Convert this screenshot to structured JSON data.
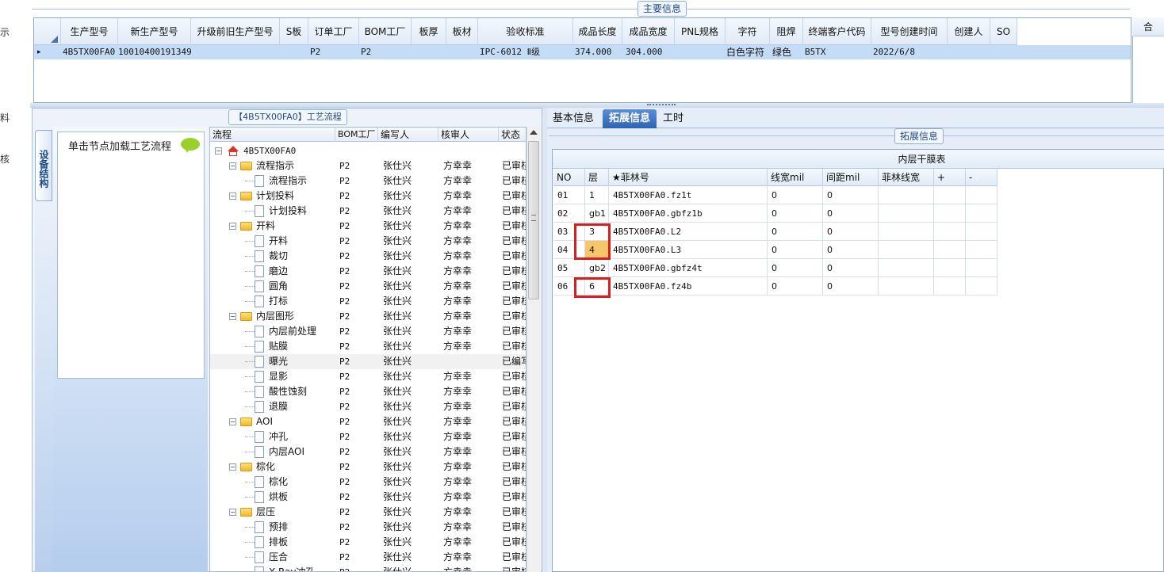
{
  "left_strip": {
    "chars": [
      "示",
      "料",
      "核"
    ]
  },
  "main_info": {
    "title": "主要信息",
    "columns": [
      "生产型号",
      "新生产型号",
      "升级前旧生产型号",
      "S板",
      "订单工厂",
      "BOM工厂",
      "板厚",
      "板材",
      "验收标准",
      "成品长度",
      "成品宽度",
      "PNL规格",
      "字符",
      "阻焊",
      "终端客户代码",
      "型号创建时间",
      "创建人",
      "SO"
    ],
    "row": {
      "indicator": "▸",
      "model": "4B5TX00FA0",
      "new_model": "10010400191349",
      "old_model": "",
      "s_board": "",
      "order_factory": "P2",
      "bom_factory": "P2",
      "thickness": "",
      "material": "",
      "standard": "IPC-6012 Ⅱ级",
      "length": "374.000",
      "width": "304.000",
      "pnl": "",
      "char": "白色字符",
      "mask": "绿色",
      "customer": "B5TX",
      "created": "2022/6/8",
      "creator": "",
      "so": ""
    },
    "right_header": "合"
  },
  "process": {
    "title": "【4B5TX00FA0】工艺流程",
    "vertical_tab": "设备结构",
    "load_hint": "单击节点加载工艺流程",
    "tree_columns": [
      "流程",
      "BOM工厂",
      "编写人",
      "核审人",
      "状态"
    ],
    "rows": [
      {
        "label": "4B5TX00FA0",
        "level": 0,
        "kind": "root",
        "bom": "",
        "writer": "",
        "reviewer": "",
        "status": ""
      },
      {
        "label": "流程指示",
        "level": 1,
        "kind": "folder",
        "bom": "P2",
        "writer": "张仕兴",
        "reviewer": "方幸幸",
        "status": "已审核"
      },
      {
        "label": "流程指示",
        "level": 2,
        "kind": "doc",
        "bom": "P2",
        "writer": "张仕兴",
        "reviewer": "方幸幸",
        "status": "已审核"
      },
      {
        "label": "计划投料",
        "level": 1,
        "kind": "folder",
        "bom": "P2",
        "writer": "张仕兴",
        "reviewer": "方幸幸",
        "status": "已审核"
      },
      {
        "label": "计划投料",
        "level": 2,
        "kind": "doc",
        "bom": "P2",
        "writer": "张仕兴",
        "reviewer": "方幸幸",
        "status": "已审核"
      },
      {
        "label": "开料",
        "level": 1,
        "kind": "folder",
        "bom": "P2",
        "writer": "张仕兴",
        "reviewer": "方幸幸",
        "status": "已审核"
      },
      {
        "label": "开料",
        "level": 2,
        "kind": "doc",
        "bom": "P2",
        "writer": "张仕兴",
        "reviewer": "方幸幸",
        "status": "已审核"
      },
      {
        "label": "裁切",
        "level": 2,
        "kind": "doc",
        "bom": "P2",
        "writer": "张仕兴",
        "reviewer": "方幸幸",
        "status": "已审核"
      },
      {
        "label": "磨边",
        "level": 2,
        "kind": "doc",
        "bom": "P2",
        "writer": "张仕兴",
        "reviewer": "方幸幸",
        "status": "已审核"
      },
      {
        "label": "圆角",
        "level": 2,
        "kind": "doc",
        "bom": "P2",
        "writer": "张仕兴",
        "reviewer": "方幸幸",
        "status": "已审核"
      },
      {
        "label": "打标",
        "level": 2,
        "kind": "doc",
        "bom": "P2",
        "writer": "张仕兴",
        "reviewer": "方幸幸",
        "status": "已审核"
      },
      {
        "label": "内层图形",
        "level": 1,
        "kind": "folder",
        "bom": "P2",
        "writer": "张仕兴",
        "reviewer": "方幸幸",
        "status": "已审核"
      },
      {
        "label": "内层前处理",
        "level": 2,
        "kind": "doc",
        "bom": "P2",
        "writer": "张仕兴",
        "reviewer": "方幸幸",
        "status": "已审核"
      },
      {
        "label": "贴膜",
        "level": 2,
        "kind": "doc",
        "bom": "P2",
        "writer": "张仕兴",
        "reviewer": "方幸幸",
        "status": "已审核"
      },
      {
        "label": "曝光",
        "level": 2,
        "kind": "doc",
        "bom": "P2",
        "writer": "张仕兴",
        "reviewer": "",
        "status": "已编写",
        "selected": true
      },
      {
        "label": "显影",
        "level": 2,
        "kind": "doc",
        "bom": "P2",
        "writer": "张仕兴",
        "reviewer": "方幸幸",
        "status": "已审核"
      },
      {
        "label": "酸性蚀刻",
        "level": 2,
        "kind": "doc",
        "bom": "P2",
        "writer": "张仕兴",
        "reviewer": "方幸幸",
        "status": "已审核"
      },
      {
        "label": "退膜",
        "level": 2,
        "kind": "doc",
        "bom": "P2",
        "writer": "张仕兴",
        "reviewer": "方幸幸",
        "status": "已审核"
      },
      {
        "label": "AOI",
        "level": 1,
        "kind": "folder",
        "bom": "P2",
        "writer": "张仕兴",
        "reviewer": "方幸幸",
        "status": "已审核"
      },
      {
        "label": "冲孔",
        "level": 2,
        "kind": "doc",
        "bom": "P2",
        "writer": "张仕兴",
        "reviewer": "方幸幸",
        "status": "已审核"
      },
      {
        "label": "内层AOI",
        "level": 2,
        "kind": "doc",
        "bom": "P2",
        "writer": "张仕兴",
        "reviewer": "方幸幸",
        "status": "已审核"
      },
      {
        "label": "棕化",
        "level": 1,
        "kind": "folder",
        "bom": "P2",
        "writer": "张仕兴",
        "reviewer": "方幸幸",
        "status": "已审核"
      },
      {
        "label": "棕化",
        "level": 2,
        "kind": "doc",
        "bom": "P2",
        "writer": "张仕兴",
        "reviewer": "方幸幸",
        "status": "已审核"
      },
      {
        "label": "烘板",
        "level": 2,
        "kind": "doc",
        "bom": "P2",
        "writer": "张仕兴",
        "reviewer": "方幸幸",
        "status": "已审核"
      },
      {
        "label": "层压",
        "level": 1,
        "kind": "folder",
        "bom": "P2",
        "writer": "张仕兴",
        "reviewer": "方幸幸",
        "status": "已审核"
      },
      {
        "label": "预排",
        "level": 2,
        "kind": "doc",
        "bom": "P2",
        "writer": "张仕兴",
        "reviewer": "方幸幸",
        "status": "已审核"
      },
      {
        "label": "排板",
        "level": 2,
        "kind": "doc",
        "bom": "P2",
        "writer": "张仕兴",
        "reviewer": "方幸幸",
        "status": "已审核"
      },
      {
        "label": "压合",
        "level": 2,
        "kind": "doc",
        "bom": "P2",
        "writer": "张仕兴",
        "reviewer": "方幸幸",
        "status": "已审核"
      },
      {
        "label": "X-Ray冲孔",
        "level": 2,
        "kind": "doc",
        "bom": "P2",
        "writer": "张仕兴",
        "reviewer": "方幸幸",
        "status": "已审核"
      }
    ]
  },
  "tabs": {
    "items": [
      "基本信息",
      "拓展信息",
      "工时"
    ],
    "active": "拓展信息"
  },
  "extended": {
    "title": "拓展信息",
    "table_caption": "内层干膜表",
    "columns": [
      "NO",
      "层",
      "★菲林号",
      "线宽mil",
      "间距mil",
      "菲林线宽",
      "+",
      "-"
    ],
    "rows": [
      {
        "no": "01",
        "layer": "1",
        "film": "4B5TX00FA0.fz1t",
        "line": "0",
        "space": "0",
        "film_line": "",
        "highlight": false
      },
      {
        "no": "02",
        "layer": "gb1",
        "film": "4B5TX00FA0.gbfz1b",
        "line": "0",
        "space": "0",
        "film_line": "",
        "highlight": false
      },
      {
        "no": "03",
        "layer": "3",
        "film": "4B5TX00FA0.L2",
        "line": "0",
        "space": "0",
        "film_line": "",
        "highlight": false
      },
      {
        "no": "04",
        "layer": "4",
        "film": "4B5TX00FA0.L3",
        "line": "0",
        "space": "0",
        "film_line": "",
        "highlight": true
      },
      {
        "no": "05",
        "layer": "gb2",
        "film": "4B5TX00FA0.gbfz4t",
        "line": "0",
        "space": "0",
        "film_line": "",
        "highlight": false
      },
      {
        "no": "06",
        "layer": "6",
        "film": "4B5TX00FA0.fz4b",
        "line": "0",
        "space": "0",
        "film_line": "",
        "highlight": false
      }
    ]
  },
  "colors": {
    "accent": "#2f64b2",
    "selection": "#c5dcf6",
    "highlight_cell": "#f7c66a",
    "annotation": "#d61f1f"
  }
}
